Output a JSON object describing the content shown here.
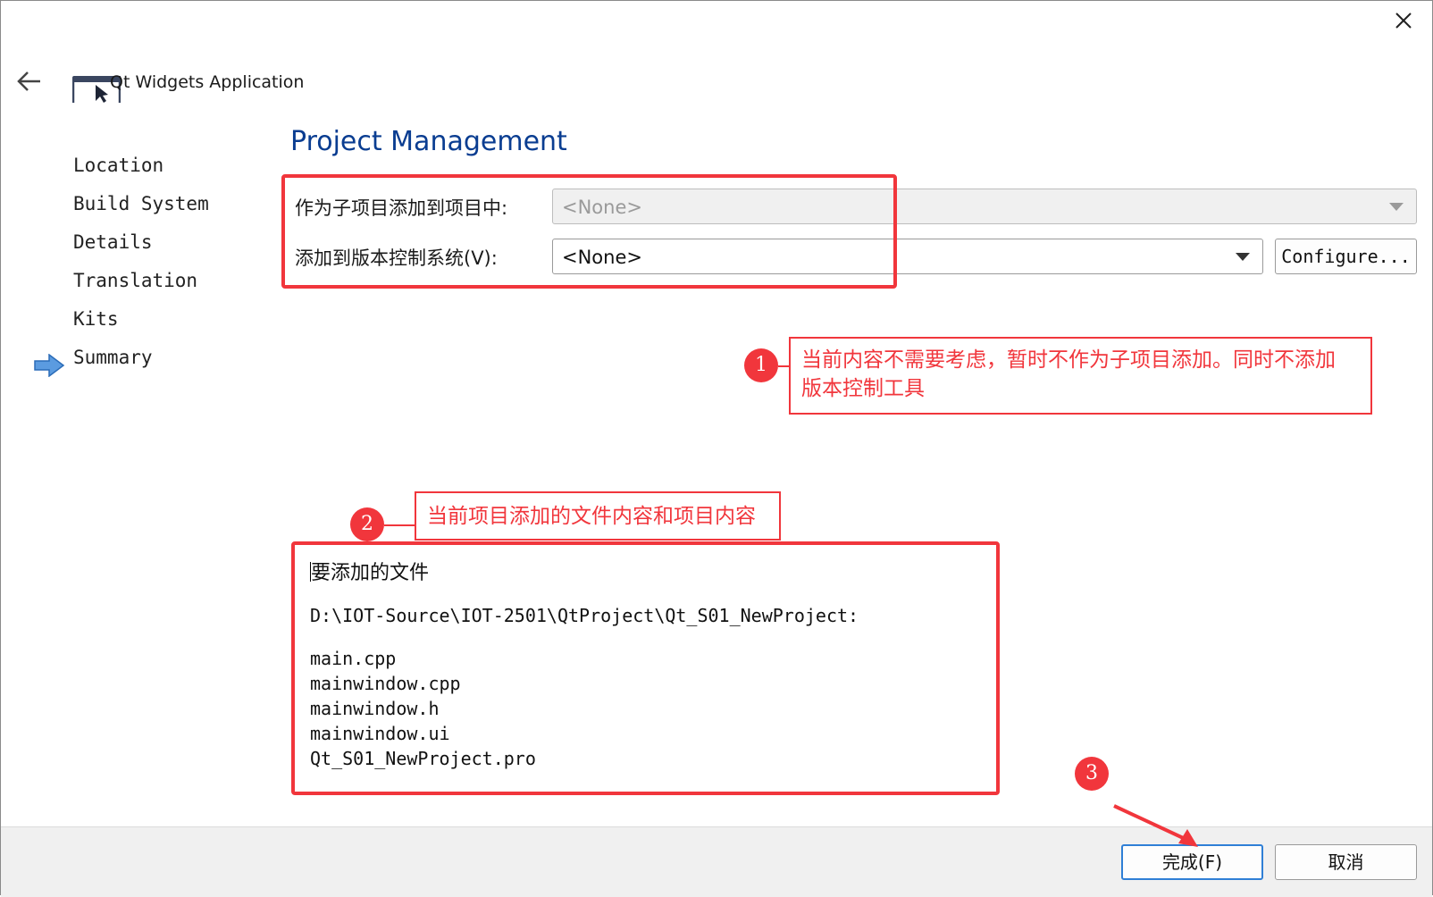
{
  "window": {
    "title": "Qt Widgets Application",
    "close_label": "close"
  },
  "nav": {
    "items": [
      {
        "label": "Location"
      },
      {
        "label": "Build System"
      },
      {
        "label": "Details"
      },
      {
        "label": "Translation"
      },
      {
        "label": "Kits"
      },
      {
        "label": "Summary",
        "current": true
      }
    ]
  },
  "page": {
    "title": "Project Management"
  },
  "form": {
    "subproject_label": "作为子项目添加到项目中:",
    "subproject_value": "<None>",
    "vcs_label": "添加到版本控制系统(V):",
    "vcs_value": "<None>",
    "configure_label": "Configure..."
  },
  "callouts": [
    {
      "number": "1",
      "text_line1": "当前内容不需要考虑，暂时不作为子项目添加。同时不添加",
      "text_line2": "版本控制工具"
    },
    {
      "number": "2",
      "text_line1": "当前项目添加的文件内容和项目内容"
    },
    {
      "number": "3"
    }
  ],
  "files": {
    "heading": "要添加的文件",
    "path": "D:\\IOT-Source\\IOT-2501\\QtProject\\Qt_S01_NewProject:",
    "list": [
      "main.cpp",
      "mainwindow.cpp",
      "mainwindow.h",
      "mainwindow.ui",
      "Qt_S01_NewProject.pro"
    ]
  },
  "footer": {
    "finish_label": "完成(F)",
    "cancel_label": "取消"
  },
  "colors": {
    "accent_red": "#f1363c",
    "title_blue": "#0a3d91",
    "primary_border": "#2f7fd6"
  }
}
